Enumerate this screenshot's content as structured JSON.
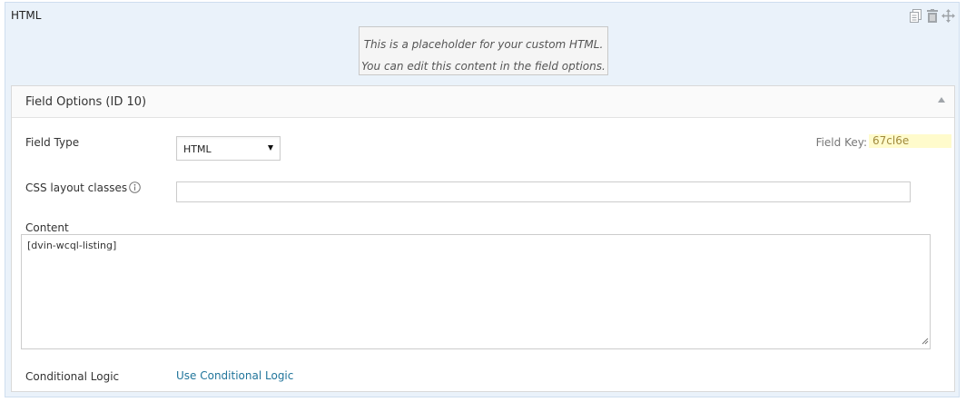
{
  "field": {
    "title": "HTML",
    "placeholder_line1": "This is a placeholder for your custom HTML.",
    "placeholder_line2": "You can edit this content in the field options."
  },
  "actions": {
    "duplicate_icon": "duplicate-icon",
    "delete_icon": "trash-icon",
    "move_icon": "move-icon"
  },
  "options": {
    "header": "Field Options (ID 10)",
    "field_type_label": "Field Type",
    "field_type_value": "HTML",
    "field_key_label": "Field Key:",
    "field_key_value": "67cl6e",
    "css_label": "CSS layout classes",
    "css_value": "",
    "content_label": "Content",
    "content_value": "[dvin-wcql-listing]",
    "conditional_label": "Conditional Logic",
    "conditional_link": "Use Conditional Logic"
  },
  "colors": {
    "panel_bg": "#eaf2fa",
    "link": "#21759b",
    "key_highlight": "#fffbcc"
  }
}
